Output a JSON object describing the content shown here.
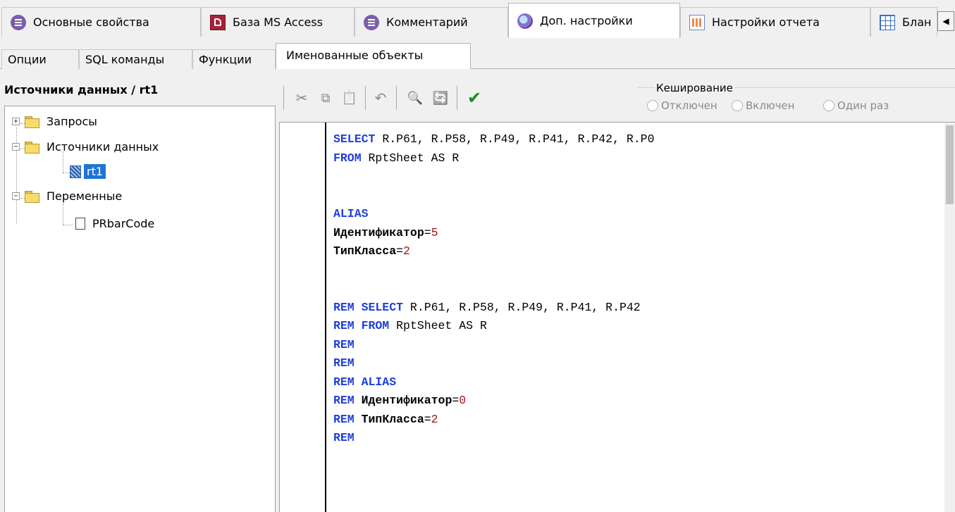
{
  "top_tabs": [
    {
      "label": "Основные свойства",
      "icon": "document-purple-icon"
    },
    {
      "label": "База MS Access",
      "icon": "access-database-icon"
    },
    {
      "label": "Комментарий",
      "icon": "document-purple-icon"
    },
    {
      "label": "Доп. настройки",
      "icon": "globe-settings-icon",
      "active": true
    },
    {
      "label": "Настройки отчета",
      "icon": "report-settings-icon"
    },
    {
      "label": "Блан",
      "icon": "grid-form-icon"
    }
  ],
  "sub_tabs": [
    {
      "label": "Опции"
    },
    {
      "label": "SQL команды"
    },
    {
      "label": "Функции"
    },
    {
      "label": "Именованные объекты",
      "active": true
    }
  ],
  "left_panel": {
    "title": "Источники данных / rt1",
    "tree": [
      {
        "label": "Запросы",
        "expander": "+"
      },
      {
        "label": "Источники данных",
        "expander": "−"
      },
      {
        "label": "rt1",
        "selected": true
      },
      {
        "label": "Переменные",
        "expander": "−"
      },
      {
        "label": "PRbarCode"
      }
    ]
  },
  "toolbar": {
    "cut": "✂",
    "copy": "⧉",
    "paste": "📋",
    "undo": "↶",
    "find": "🔍",
    "replace": "🔄",
    "apply": "✔"
  },
  "caching": {
    "legend": "Кеширование",
    "options": [
      "Отключен",
      "Включен",
      "Один раз"
    ]
  },
  "code_lines": [
    [
      [
        "kw",
        "SELECT"
      ],
      [
        "tx",
        " R.P61, R.P58, R.P49, R.P41, R.P42, R.P0"
      ]
    ],
    [
      [
        "kw",
        "FROM"
      ],
      [
        "tx",
        " RptSheet AS R"
      ]
    ],
    [],
    [],
    [
      [
        "kw",
        "ALIAS"
      ]
    ],
    [
      [
        "id",
        "Идентификатор"
      ],
      [
        "tx",
        "="
      ],
      [
        "num",
        "5"
      ]
    ],
    [
      [
        "id",
        "ТипКласса"
      ],
      [
        "tx",
        "="
      ],
      [
        "num",
        "2"
      ]
    ],
    [],
    [],
    [
      [
        "kw",
        "REM SELECT"
      ],
      [
        "tx",
        " R.P61, R.P58, R.P49, R.P41, R.P42"
      ]
    ],
    [
      [
        "kw",
        "REM FROM"
      ],
      [
        "tx",
        " RptSheet AS R"
      ]
    ],
    [
      [
        "kw",
        "REM"
      ]
    ],
    [
      [
        "kw",
        "REM"
      ]
    ],
    [
      [
        "kw",
        "REM ALIAS"
      ]
    ],
    [
      [
        "kw",
        "REM"
      ],
      [
        "id",
        " Идентификатор"
      ],
      [
        "tx",
        "="
      ],
      [
        "num",
        "0"
      ]
    ],
    [
      [
        "kw",
        "REM"
      ],
      [
        "id",
        " ТипКласса"
      ],
      [
        "tx",
        "="
      ],
      [
        "num",
        "2"
      ]
    ],
    [
      [
        "kw",
        "REM"
      ]
    ]
  ]
}
